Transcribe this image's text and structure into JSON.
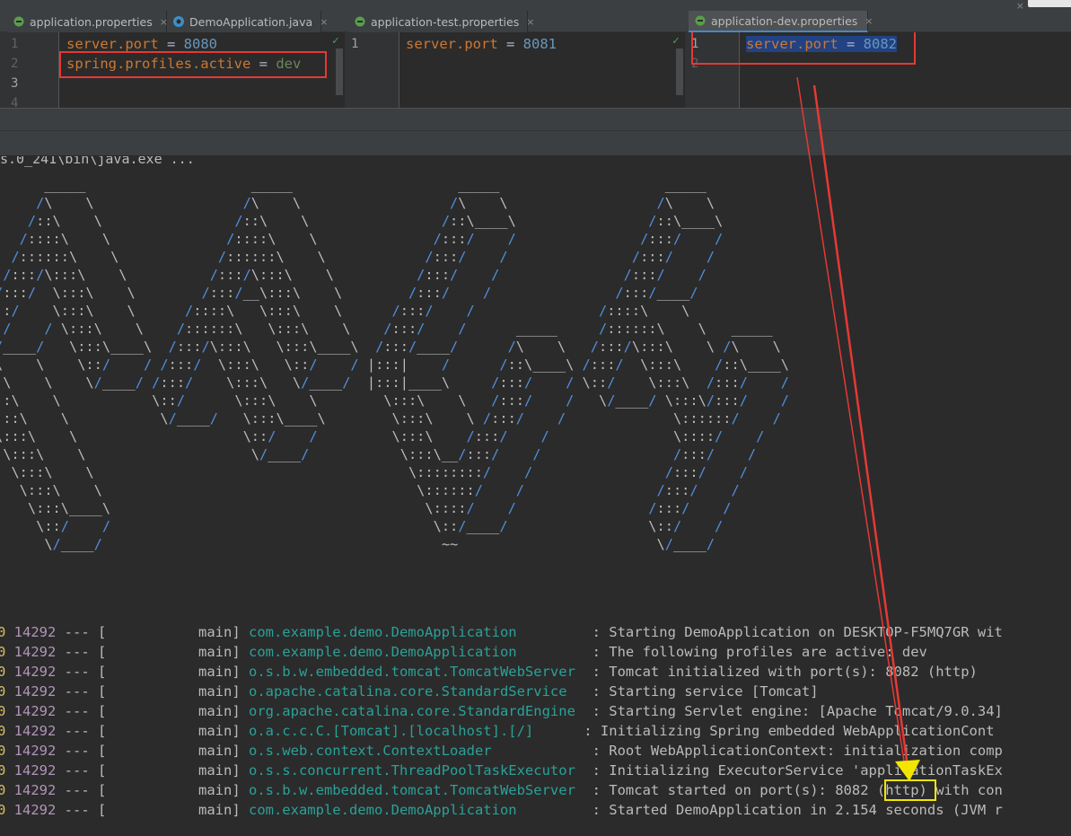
{
  "tabs": [
    {
      "label": "application.properties",
      "icon": "properties-file-icon"
    },
    {
      "label": "DemoApplication.java",
      "icon": "java-class-icon"
    },
    {
      "label": "application-test.properties",
      "icon": "properties-file-icon"
    },
    {
      "label": "application-dev.properties",
      "icon": "properties-file-icon"
    }
  ],
  "close_glyph": "×",
  "editors": {
    "main": {
      "line_numbers": [
        "1",
        "2",
        "3",
        "4"
      ],
      "line1": {
        "key": "server.port",
        "eq": " = ",
        "value": "8080"
      },
      "line2": {
        "key": "spring.profiles.active",
        "eq": " = ",
        "value": "dev"
      }
    },
    "test": {
      "line_numbers": [
        "1"
      ],
      "line1": {
        "key": "server.port",
        "eq": " = ",
        "value": "8081"
      }
    },
    "dev": {
      "line_numbers": [
        "1",
        "2"
      ],
      "line1": {
        "key": "server.port",
        "eq": " = ",
        "value": "8082"
      }
    }
  },
  "console": {
    "command_line": "s.0_241\\bin\\java.exe ...",
    "banner_lines": [
      "      _____                    _____                    _____                    _____",
      "     /\\    \\                  /\\    \\                  /\\    \\                  /\\    \\",
      "    /::\\    \\                /::\\    \\                /::\\____\\                /::\\____\\",
      "   /::::\\    \\              /::::\\    \\              /:::/    /               /:::/    /",
      "  /::::::\\    \\            /::::::\\    \\            /:::/    /               /:::/    /",
      " /:::/\\:::\\    \\          /:::/\\:::\\    \\          /:::/    /               /:::/    /",
      "/:::/  \\:::\\    \\        /:::/__\\:::\\    \\        /:::/    /               /:::/____/",
      "::/    \\:::\\    \\      /::::\\   \\:::\\    \\      /:::/    /               /::::\\    \\",
      ":/    / \\:::\\    \\    /::::::\\   \\:::\\    \\    /:::/    /      _____     /::::::\\    \\   _____",
      "/____/   \\:::\\____\\  /:::/\\:::\\   \\:::\\____\\  /:::/____/      /\\    \\   /:::/\\:::\\    \\ /\\    \\",
      "\\    \\    \\::/    / /:::/  \\:::\\   \\::/    / |:::|    /      /::\\____\\ /:::/  \\:::\\    /::\\____\\",
      ":\\    \\    \\/____/ /:::/    \\:::\\   \\/____/  |:::|____\\     /:::/    / \\::/    \\:::\\  /:::/    /",
      "::\\    \\           \\::/      \\:::\\    \\        \\:::\\    \\   /:::/    /   \\/____/ \\:::\\/:::/    /",
      ":::\\    \\           \\/____/   \\:::\\____\\        \\:::\\    \\ /:::/    /             \\::::::/    /",
      "\\:::\\    \\                    \\::/    /         \\:::\\    /:::/    /               \\::::/    /",
      " \\:::\\    \\                    \\/____/           \\:::\\__/:::/    /                /:::/    /",
      "  \\:::\\    \\                                      \\::::::::/    /                /:::/    /",
      "   \\:::\\    \\                                      \\::::::/    /                /:::/    /",
      "    \\:::\\____\\                                      \\::::/    /                /:::/    /",
      "     \\::/    /                                       \\::/____/                 \\::/    /",
      "      \\/____/                                         ~~                        \\/____/"
    ],
    "log_lines": [
      {
        "lead": "0",
        "pid": "14292",
        "sep": " --- [",
        "thread": "           main] ",
        "logger": "com.example.demo.DemoApplication        ",
        "msg": " : Starting DemoApplication on DESKTOP-F5MQ7GR wit"
      },
      {
        "lead": "0",
        "pid": "14292",
        "sep": " --- [",
        "thread": "           main] ",
        "logger": "com.example.demo.DemoApplication        ",
        "msg": " : The following profiles are active: dev"
      },
      {
        "lead": "0",
        "pid": "14292",
        "sep": " --- [",
        "thread": "           main] ",
        "logger": "o.s.b.w.embedded.tomcat.TomcatWebServer ",
        "msg": " : Tomcat initialized with port(s): 8082 (http)"
      },
      {
        "lead": "0",
        "pid": "14292",
        "sep": " --- [",
        "thread": "           main] ",
        "logger": "o.apache.catalina.core.StandardService  ",
        "msg": " : Starting service [Tomcat]"
      },
      {
        "lead": "0",
        "pid": "14292",
        "sep": " --- [",
        "thread": "           main] ",
        "logger": "org.apache.catalina.core.StandardEngine ",
        "msg": " : Starting Servlet engine: [Apache Tomcat/9.0.34]"
      },
      {
        "lead": "0",
        "pid": "14292",
        "sep": " --- [",
        "thread": "           main] ",
        "logger": "o.a.c.c.C.[Tomcat].[localhost].[/]     ",
        "msg": " : Initializing Spring embedded WebApplicationCont"
      },
      {
        "lead": "0",
        "pid": "14292",
        "sep": " --- [",
        "thread": "           main] ",
        "logger": "o.s.web.context.ContextLoader           ",
        "msg": " : Root WebApplicationContext: initialization comp"
      },
      {
        "lead": "0",
        "pid": "14292",
        "sep": " --- [",
        "thread": "           main] ",
        "logger": "o.s.s.concurrent.ThreadPoolTaskExecutor ",
        "msg": " : Initializing ExecutorService 'applicationTaskEx"
      },
      {
        "lead": "0",
        "pid": "14292",
        "sep": " --- [",
        "thread": "           main] ",
        "logger": "o.s.b.w.embedded.tomcat.TomcatWebServer ",
        "msg": " : Tomcat started on port(s): 8082 (http) with con"
      },
      {
        "lead": "0",
        "pid": "14292",
        "sep": " --- [",
        "thread": "           main] ",
        "logger": "com.example.demo.DemoApplication        ",
        "msg": " : Started DemoApplication in 2.154 seconds (JVM r"
      }
    ]
  },
  "colors": {
    "annotation_red": "#e53935",
    "annotation_yellow": "#f2e600",
    "key_orange": "#cc7832",
    "number_blue": "#6897bb",
    "value_green": "#6a8759",
    "logger_cyan": "#2aa198",
    "pid_purple": "#b294bb"
  }
}
